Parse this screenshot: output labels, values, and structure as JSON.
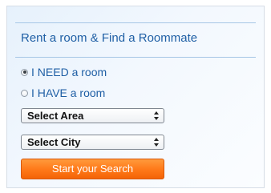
{
  "widget": {
    "title": "Rent a room & Find a Roommate",
    "options": [
      {
        "label": "I NEED a room",
        "selected": true
      },
      {
        "label": "I HAVE a room",
        "selected": false
      }
    ],
    "area_select": {
      "value": "Select Area"
    },
    "city_select": {
      "value": "Select City"
    },
    "search_button": "Start your Search"
  },
  "colors": {
    "heading_text": "#1f5fa5",
    "divider": "#a6c6e6",
    "button_orange": "#ff7a1a",
    "panel_background": "#e6f1fc"
  }
}
